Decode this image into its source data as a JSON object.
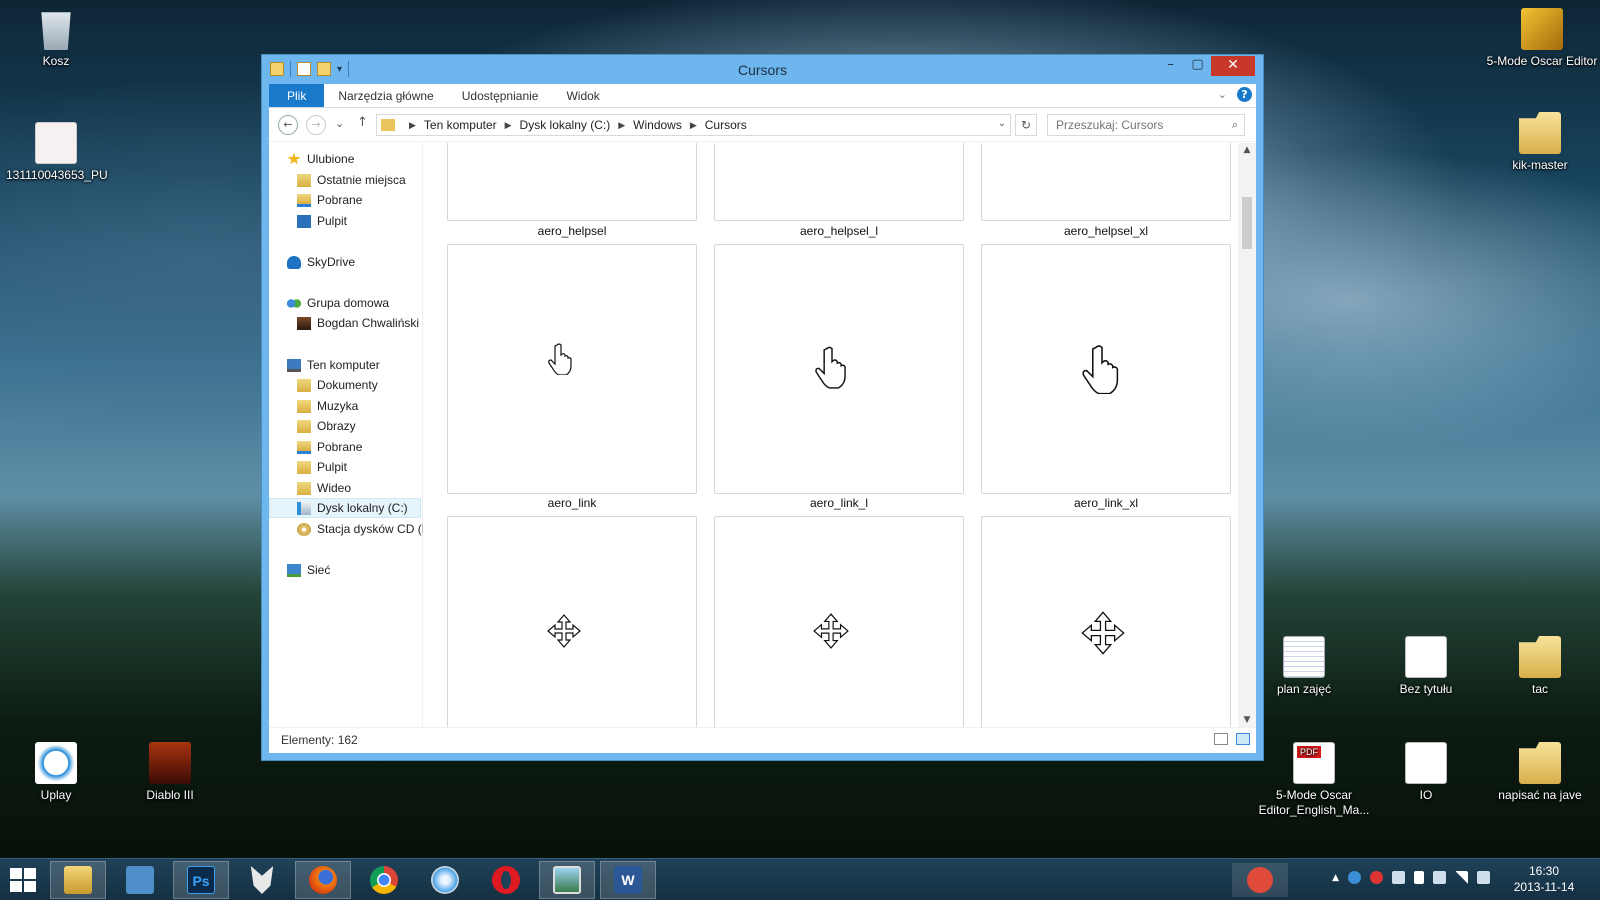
{
  "desktop": {
    "icons": [
      {
        "label": "Kosz",
        "icon": "recycle-bin-icon"
      },
      {
        "label": "131110043653_PU",
        "icon": "image-file-icon"
      },
      {
        "label": "Uplay",
        "icon": "uplay-icon"
      },
      {
        "label": "Diablo III",
        "icon": "diablo-icon"
      },
      {
        "label": "5-Mode Oscar Editor",
        "icon": "x7-app-icon"
      },
      {
        "label": "kik-master",
        "icon": "folder-icon"
      },
      {
        "label": "plan zajęć",
        "icon": "spreadsheet-icon"
      },
      {
        "label": "Bez tytułu",
        "icon": "document-icon"
      },
      {
        "label": "tac",
        "icon": "folder-icon"
      },
      {
        "label": "5-Mode Oscar Editor_English_Ma...",
        "icon": "pdf-icon"
      },
      {
        "label": "IO",
        "icon": "text-file-icon"
      },
      {
        "label": "napisać na jave",
        "icon": "folder-icon"
      }
    ]
  },
  "window": {
    "title": "Cursors",
    "ribbon_tabs": [
      "Plik",
      "Narzędzia główne",
      "Udostępnianie",
      "Widok"
    ],
    "breadcrumb": [
      "Ten komputer",
      "Dysk lokalny (C:)",
      "Windows",
      "Cursors"
    ],
    "search_placeholder": "Przeszukaj: Cursors",
    "nav": {
      "favorites": "Ulubione",
      "recent": "Ostatnie miejsca",
      "downloads": "Pobrane",
      "desktop": "Pulpit",
      "skydrive": "SkyDrive",
      "homegroup": "Grupa domowa",
      "user": "Bogdan Chwaliński",
      "this_pc": "Ten komputer",
      "documents": "Dokumenty",
      "music": "Muzyka",
      "pictures": "Obrazy",
      "downloads2": "Pobrane",
      "desktop2": "Pulpit",
      "videos": "Wideo",
      "local_disk": "Dysk lokalny (C:)",
      "cd_drive": "Stacja dysków CD (D",
      "network": "Sieć"
    },
    "files": [
      {
        "name": "aero_helpsel",
        "cursor": "none"
      },
      {
        "name": "aero_helpsel_l",
        "cursor": "none"
      },
      {
        "name": "aero_helpsel_xl",
        "cursor": "none"
      },
      {
        "name": "aero_link",
        "cursor": "hand-cursor-icon"
      },
      {
        "name": "aero_link_l",
        "cursor": "hand-cursor-icon"
      },
      {
        "name": "aero_link_xl",
        "cursor": "hand-cursor-icon"
      },
      {
        "name": "",
        "cursor": "move-cursor-icon"
      },
      {
        "name": "",
        "cursor": "move-cursor-icon"
      },
      {
        "name": "",
        "cursor": "move-cursor-icon"
      }
    ],
    "status": "Elementy: 162"
  },
  "taskbar": {
    "apps": [
      "file-explorer",
      "control-panel",
      "photoshop",
      "xbmc",
      "firefox",
      "chrome",
      "safari",
      "opera",
      "photos",
      "word"
    ],
    "clock_time": "16:30",
    "clock_date": "2013-11-14"
  }
}
